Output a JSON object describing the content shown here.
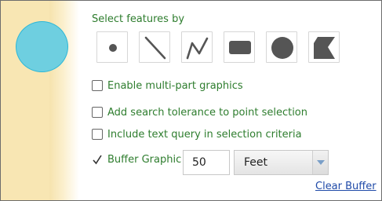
{
  "panel": {
    "heading": "Select features by",
    "tools": [
      {
        "name": "point-tool",
        "icon": "point-icon"
      },
      {
        "name": "line-tool",
        "icon": "line-icon"
      },
      {
        "name": "polyline-tool",
        "icon": "polyline-icon"
      },
      {
        "name": "rectangle-tool",
        "icon": "rectangle-icon"
      },
      {
        "name": "circle-tool",
        "icon": "circle-icon"
      },
      {
        "name": "polygon-tool",
        "icon": "polygon-icon"
      }
    ],
    "options": [
      {
        "label": "Enable multi-part graphics",
        "checked": false
      },
      {
        "label": "Add search tolerance to point selection",
        "checked": false
      },
      {
        "label": "Include text query in selection criteria",
        "checked": false
      }
    ],
    "buffer": {
      "label": "Buffer Graphic",
      "checked": true,
      "distance": "50",
      "unit": "Feet"
    },
    "clear_label": "Clear Buffer"
  },
  "colors": {
    "label_green": "#2e7d2e",
    "link_blue": "#1f4aa8",
    "map_bg": "#f8e6b3",
    "graphic_fill": "#6ecfe0",
    "graphic_stroke": "#2cb7d8",
    "tool_icon": "#555555"
  }
}
